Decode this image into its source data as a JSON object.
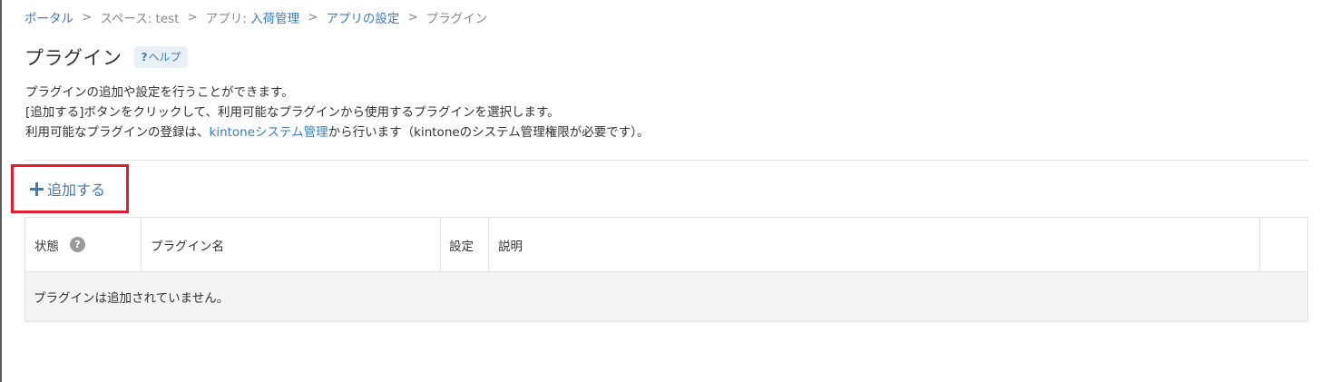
{
  "breadcrumb": {
    "portal": "ポータル",
    "space": "スペース: test",
    "app_prefix": "アプリ: ",
    "app_name": "入荷管理",
    "app_settings": "アプリの設定",
    "current": "プラグイン",
    "separator": ">"
  },
  "header": {
    "title": "プラグイン",
    "help_q": "?",
    "help_label": "ヘルプ"
  },
  "description": {
    "line1": "プラグインの追加や設定を行うことができます。",
    "line2": "[追加する]ボタンをクリックして、利用可能なプラグインから使用するプラグインを選択します。",
    "line3_before": "利用可能なプラグインの登録は、",
    "line3_link": "kintoneシステム管理",
    "line3_after": "から行います（kintoneのシステム管理権限が必要です）。"
  },
  "toolbar": {
    "add_label": "追加する",
    "highlight_color": "#e01e2d"
  },
  "table": {
    "columns": {
      "status": "状態",
      "name": "プラグイン名",
      "setting": "設定",
      "description": "説明"
    },
    "status_help_icon": "?",
    "empty_message": "プラグインは追加されていません。"
  },
  "colors": {
    "link": "#3a7bbd",
    "text": "#333333",
    "muted": "#888888"
  }
}
